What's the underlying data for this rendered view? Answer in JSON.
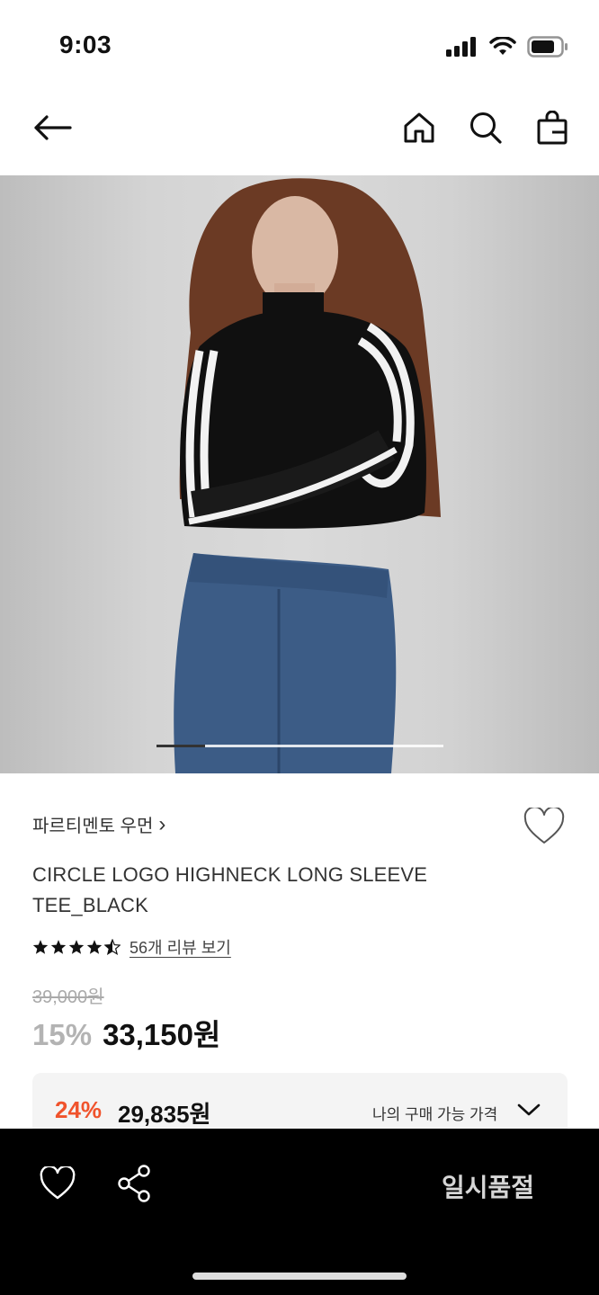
{
  "status_bar": {
    "time": "9:03",
    "icons": [
      "signal-icon",
      "wifi-icon",
      "battery-icon"
    ]
  },
  "nav": {
    "back_icon": "arrow-left-icon",
    "actions": [
      "home-icon",
      "search-icon",
      "shopping-bag-icon"
    ]
  },
  "gallery": {
    "description_icon": "product-photo",
    "current_index": 1,
    "progress_fraction": 0.17
  },
  "product": {
    "brand": "파르티멘토 우먼",
    "brand_chevron": "›",
    "title": "CIRCLE LOGO HIGHNECK LONG SLEEVE TEE_BLACK",
    "rating": 4.5,
    "review_link": "56개 리뷰 보기",
    "original_price": "39,000원",
    "discount_rate": "15%",
    "sale_price": "33,150원"
  },
  "benefit": {
    "discount_rate": "24%",
    "price": "29,835원",
    "label": "나의 구매 가능 가격"
  },
  "bottom_bar": {
    "status_label": "일시품절"
  },
  "colors": {
    "accent_orange": "#f0532c",
    "muted_gray": "#b3b3b3",
    "bar_black": "#000000"
  }
}
